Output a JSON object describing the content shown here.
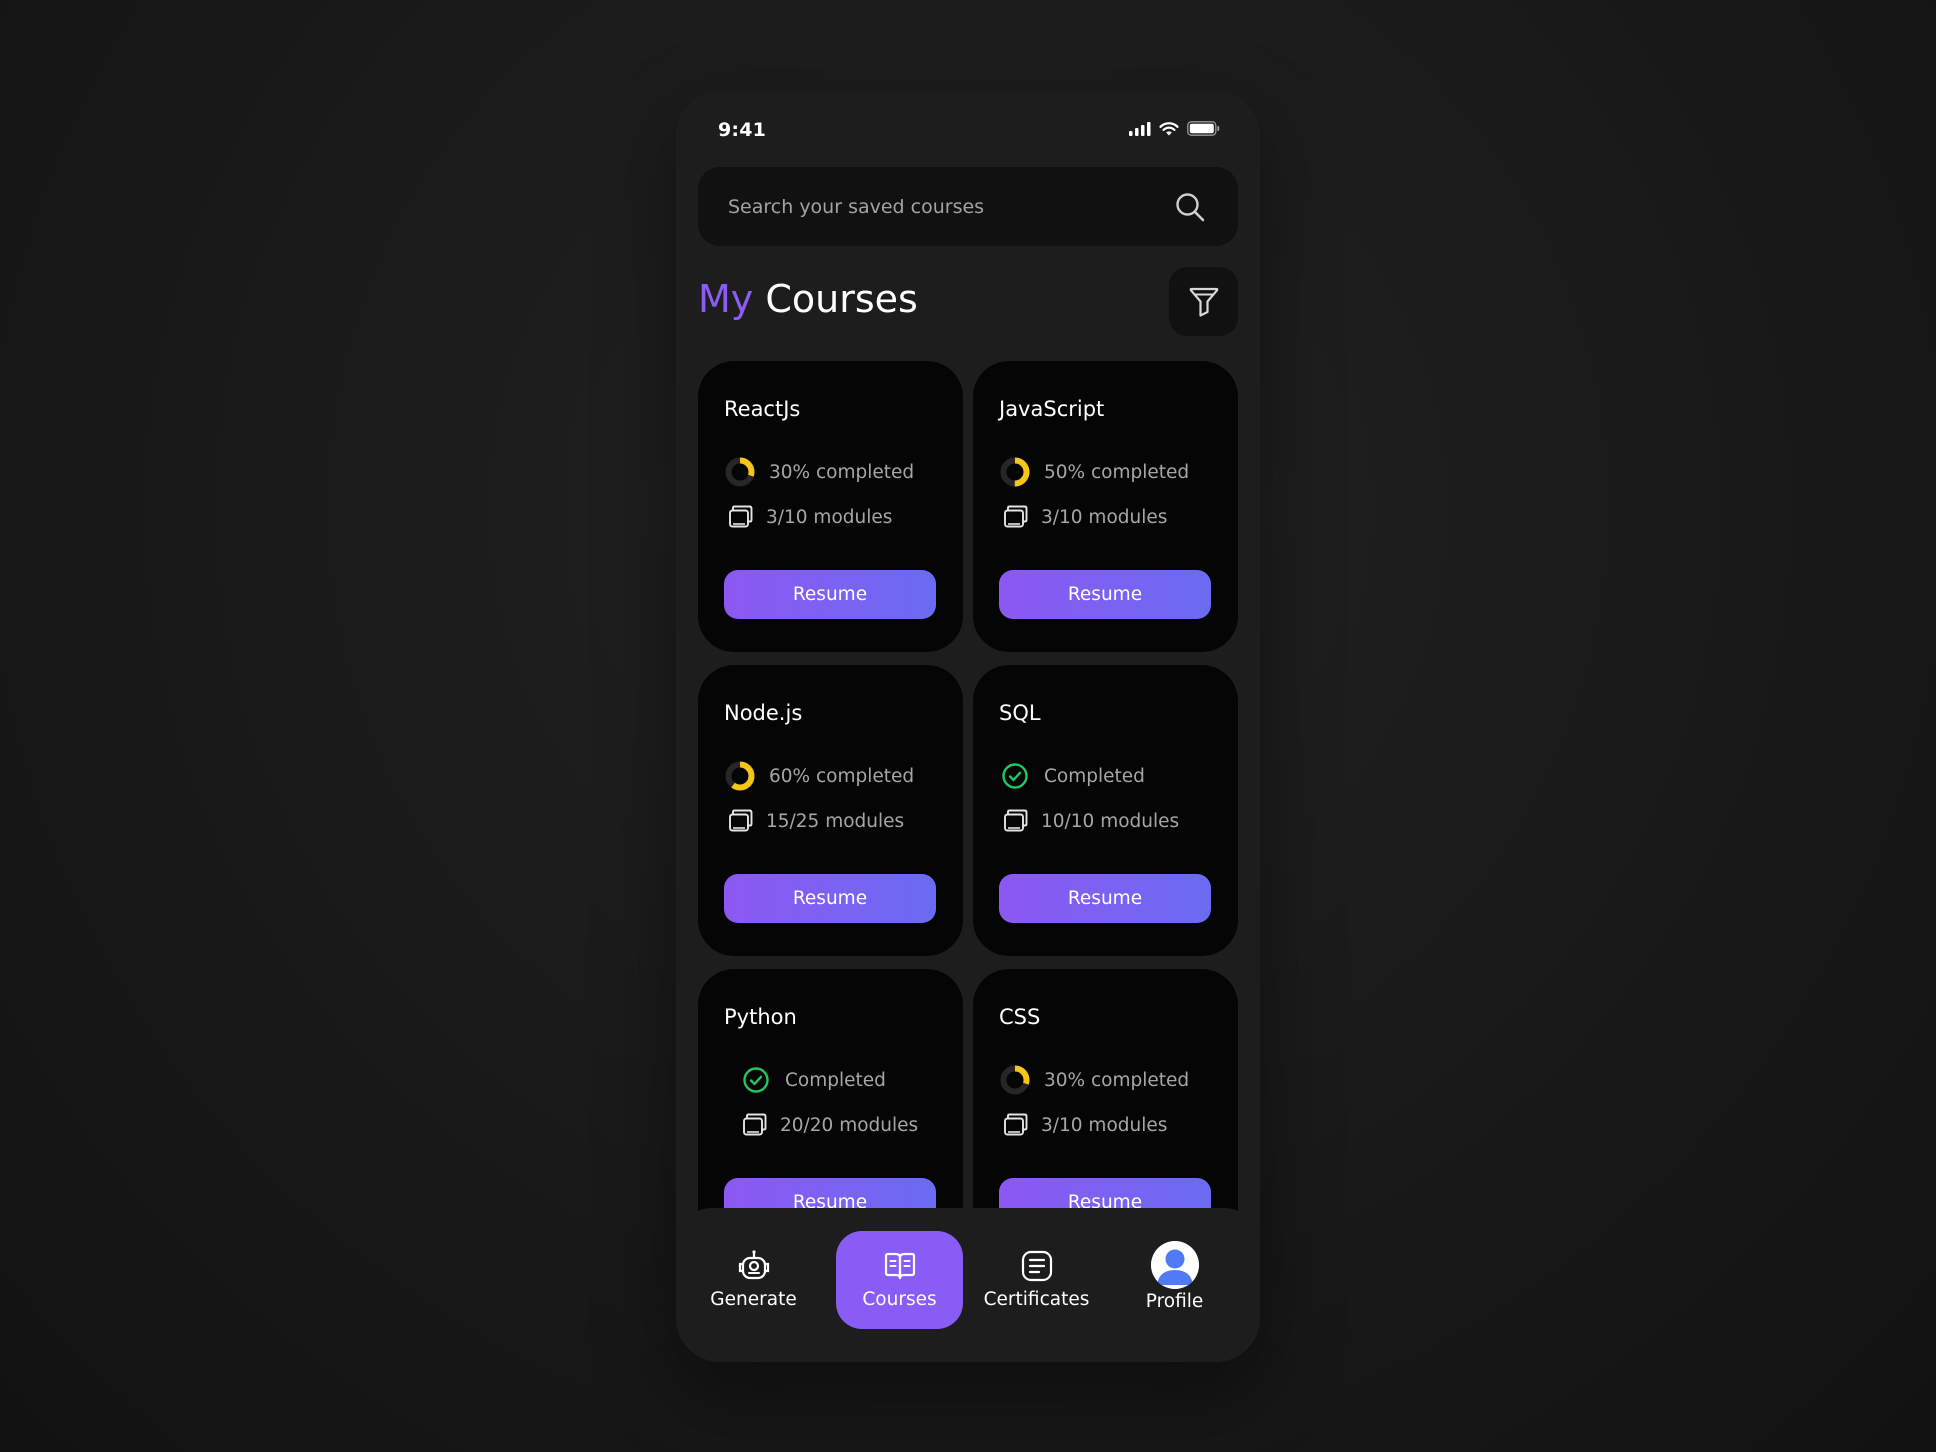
{
  "status_bar": {
    "time": "9:41"
  },
  "search": {
    "placeholder": "Search your saved courses"
  },
  "header": {
    "title_accent": "My",
    "title_rest": "Courses"
  },
  "colors": {
    "accent": "#8b5cf6",
    "progress_yellow": "#f5c518",
    "complete_green": "#22c55e",
    "card_bg": "#050505",
    "button_gradient_start": "#8d58f3",
    "button_gradient_end": "#6a6bf1"
  },
  "courses": [
    {
      "title": "ReactJs",
      "progress_text": "30% completed",
      "progress": 0.3,
      "status": "in-progress",
      "modules_text": "3/10 modules",
      "button_label": "Resume"
    },
    {
      "title": "JavaScript",
      "progress_text": "50% completed",
      "progress": 0.5,
      "status": "in-progress",
      "modules_text": "3/10 modules",
      "button_label": "Resume"
    },
    {
      "title": "Node.js",
      "progress_text": "60% completed",
      "progress": 0.6,
      "status": "in-progress",
      "modules_text": "15/25 modules",
      "button_label": "Resume"
    },
    {
      "title": "SQL",
      "progress_text": "Completed",
      "progress": 1.0,
      "status": "completed",
      "modules_text": "10/10 modules",
      "button_label": "Resume"
    },
    {
      "title": "Python",
      "progress_text": "Completed",
      "progress": 1.0,
      "status": "completed",
      "modules_text": "20/20 modules",
      "button_label": "Resume"
    },
    {
      "title": "CSS",
      "progress_text": "30% completed",
      "progress": 0.3,
      "status": "in-progress",
      "modules_text": "3/10 modules",
      "button_label": "Resume"
    }
  ],
  "nav": {
    "items": [
      {
        "label": "Generate",
        "icon": "robot-icon"
      },
      {
        "label": "Courses",
        "icon": "book-open-icon",
        "active": true
      },
      {
        "label": "Certificates",
        "icon": "certificate-icon"
      },
      {
        "label": "Profile",
        "icon": "avatar"
      }
    ]
  }
}
